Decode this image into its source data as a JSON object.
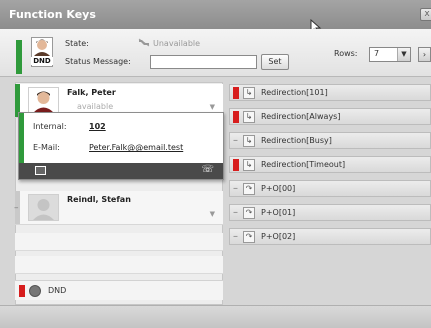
{
  "window": {
    "title": "Function Keys",
    "close_label": "x"
  },
  "header": {
    "state_label": "State:",
    "state_value": "Unavailable",
    "status_message_label": "Status Message:",
    "status_message_value": "",
    "set_label": "Set",
    "rows_label": "Rows:",
    "rows_value": "7",
    "dnd_badge": "DND"
  },
  "contacts": [
    {
      "name": "Falk, Peter",
      "status": "available",
      "state_color": "#2f9a3b"
    },
    {
      "name": "Reindl, Stefan",
      "status": "",
      "state_color": "#c9c9c9"
    }
  ],
  "popup": {
    "internal_label": "Internal:",
    "internal_value": "102",
    "email_label": "E-Mail:",
    "email_value": "Peter.Falk@@email.test"
  },
  "dnd_row": {
    "label": "DND"
  },
  "function_keys": [
    {
      "label": "Redirection[101]",
      "indicator": "red",
      "icon": "redirect-icon"
    },
    {
      "label": "Redirection[Always]",
      "indicator": "red",
      "icon": "redirect-icon"
    },
    {
      "label": "Redirection[Busy]",
      "indicator": "dash",
      "icon": "redirect-icon"
    },
    {
      "label": "Redirection[Timeout]",
      "indicator": "red",
      "icon": "redirect-icon"
    },
    {
      "label": "P+O[00]",
      "indicator": "dash",
      "icon": "pickup-icon"
    },
    {
      "label": "P+O[01]",
      "indicator": "dash",
      "icon": "pickup-icon"
    },
    {
      "label": "P+O[02]",
      "indicator": "dash",
      "icon": "pickup-icon"
    }
  ]
}
